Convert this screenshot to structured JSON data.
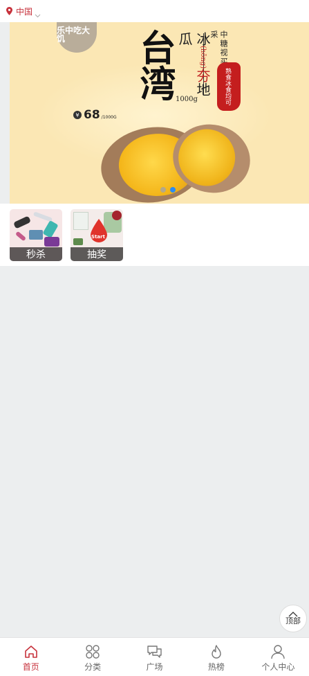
{
  "header": {
    "location": "中国",
    "location_icon": "map-pin-icon",
    "caret_icon": "chevron-down-icon",
    "accent_color": "#c7323c"
  },
  "banner": {
    "badge_text": "乐中吃大饥",
    "title": "台湾",
    "product_line": [
      "冰",
      "(hōng)",
      "夯",
      "地",
      "瓜"
    ],
    "weight": "1000g",
    "origin_line": "中糖视买网产地直采",
    "seal_text": "熟食冰食均可",
    "price_symbol": "¥",
    "price": "68",
    "price_unit": "/1000G",
    "slides_total": 2,
    "active_slide": 2,
    "dot_active_color": "#2d8cf0"
  },
  "entries": [
    {
      "label": "秒杀"
    },
    {
      "label": "抽奖",
      "badge": "Start"
    }
  ],
  "back_to_top": {
    "label": "顶部",
    "icon": "chevron-up-icon"
  },
  "tabbar": [
    {
      "label": "首页",
      "icon": "home-icon",
      "active": true
    },
    {
      "label": "分类",
      "icon": "grid-icon",
      "active": false
    },
    {
      "label": "广场",
      "icon": "chat-bubbles-icon",
      "active": false
    },
    {
      "label": "热榜",
      "icon": "flame-icon",
      "active": false
    },
    {
      "label": "个人中心",
      "icon": "user-icon",
      "active": false
    }
  ]
}
